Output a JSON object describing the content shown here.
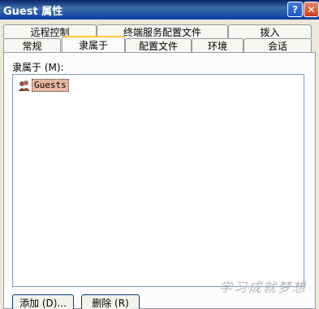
{
  "window": {
    "title": "Guest 属性"
  },
  "titlebar_buttons": {
    "help": "?",
    "close": "✕"
  },
  "tabs": {
    "row1": [
      {
        "label": "远程控制"
      },
      {
        "label": "终端服务配置文件"
      },
      {
        "label": "拨入"
      }
    ],
    "row2": [
      {
        "label": "常规"
      },
      {
        "label": "隶属于",
        "selected": true
      },
      {
        "label": "配置文件"
      },
      {
        "label": "环境"
      },
      {
        "label": "会话"
      }
    ]
  },
  "memberof": {
    "label": "隶属于 (M):",
    "items": [
      {
        "name": "Guests",
        "icon": "group-icon",
        "selected": true
      }
    ]
  },
  "buttons": {
    "add": "添加 (D)...",
    "remove": "删除 (R)"
  },
  "watermark": "学习成就梦想",
  "colors": {
    "titlebar": "#0a246a",
    "active_tab_accent": "#ffc83c",
    "selection": "#e8b6a0"
  }
}
